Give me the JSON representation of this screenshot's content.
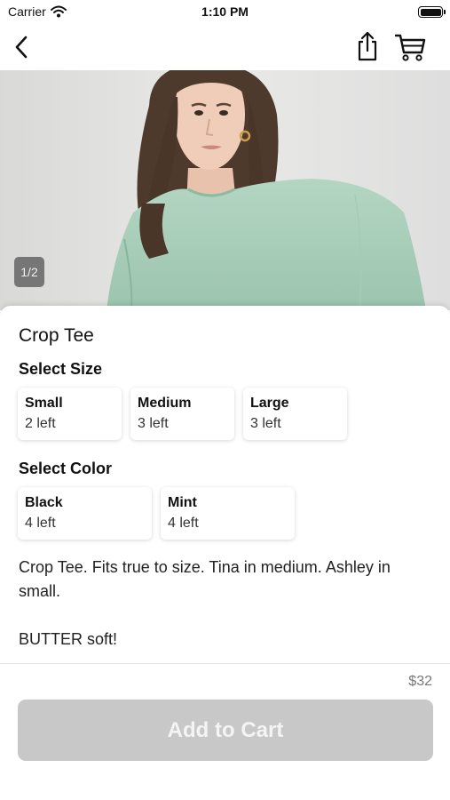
{
  "status_bar": {
    "carrier": "Carrier",
    "time": "1:10 PM"
  },
  "nav": {
    "icons": [
      "chevron-left-icon",
      "share-icon",
      "cart-icon"
    ]
  },
  "gallery": {
    "counter": "1/2",
    "shirt_color": "#a8cdb8"
  },
  "product": {
    "title": "Crop Tee",
    "sizes_label": "Select Size",
    "sizes": [
      {
        "name": "Small",
        "stock": "2 left"
      },
      {
        "name": "Medium",
        "stock": "3 left"
      },
      {
        "name": "Large",
        "stock": "3 left"
      }
    ],
    "colors_label": "Select Color",
    "colors": [
      {
        "name": "Black",
        "stock": "4 left"
      },
      {
        "name": "Mint",
        "stock": "4 left"
      }
    ],
    "description_line1": "Crop Tee. Fits true to size. Tina in medium. Ashley in small.",
    "description_line2": "BUTTER soft!"
  },
  "footer": {
    "price": "$32",
    "add_to_cart": "Add to Cart",
    "button_color": "#c8c8c8"
  }
}
